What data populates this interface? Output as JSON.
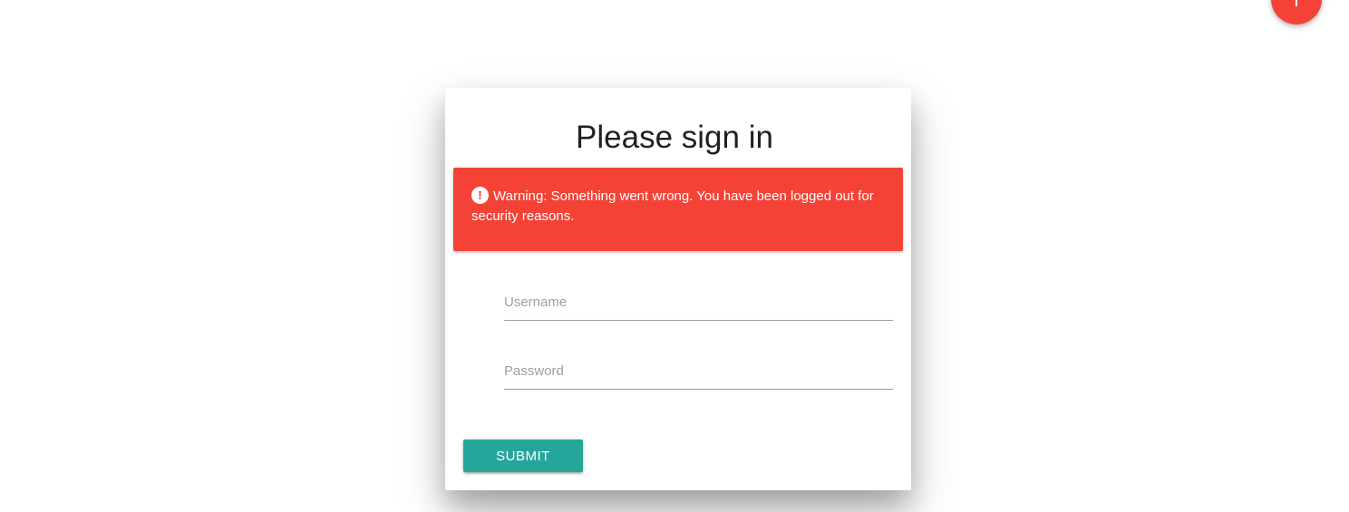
{
  "fab": {
    "icon": "plus-icon",
    "color": "#f44336"
  },
  "signin": {
    "title": "Please sign in",
    "alert": {
      "icon": "alert-circle-icon",
      "icon_glyph": "!",
      "message": "Warning: Something went wrong. You have been logged out for security reasons.",
      "color": "#f44336"
    },
    "username": {
      "value": "",
      "placeholder": "Username"
    },
    "password": {
      "value": "",
      "placeholder": "Password"
    },
    "submit_label": "SUBMIT",
    "submit_color": "#26a69a"
  }
}
